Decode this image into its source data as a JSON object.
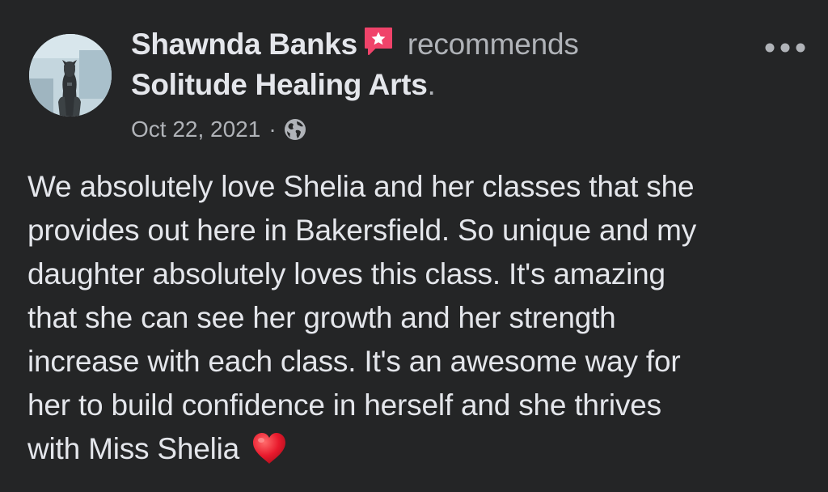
{
  "post": {
    "author": "Shawnda Banks",
    "action": "recommends",
    "page_name": "Solitude Healing Arts",
    "page_period": ".",
    "date": "Oct 22, 2021",
    "separator": "·",
    "privacy_icon": "globe-icon",
    "recommend_icon": "recommend-flag-icon",
    "more_icon": "more-options-icon",
    "body_lines": [
      "We absolutely love Shelia and her classes that she",
      "provides out here in Bakersfield. So unique and my",
      "daughter absolutely loves this class. It's amazing",
      "that she can see her growth and her strength",
      "increase with each class. It's an awesome way for",
      "her to build confidence in herself and she thrives",
      "with Miss Shelia"
    ],
    "end_emoji": "red-heart-icon"
  },
  "colors": {
    "background": "#242526",
    "primary_text": "#e4e6eb",
    "secondary_text": "#b0b3b8",
    "recommend_badge": "#f0436a",
    "heart": "#e8192c"
  }
}
